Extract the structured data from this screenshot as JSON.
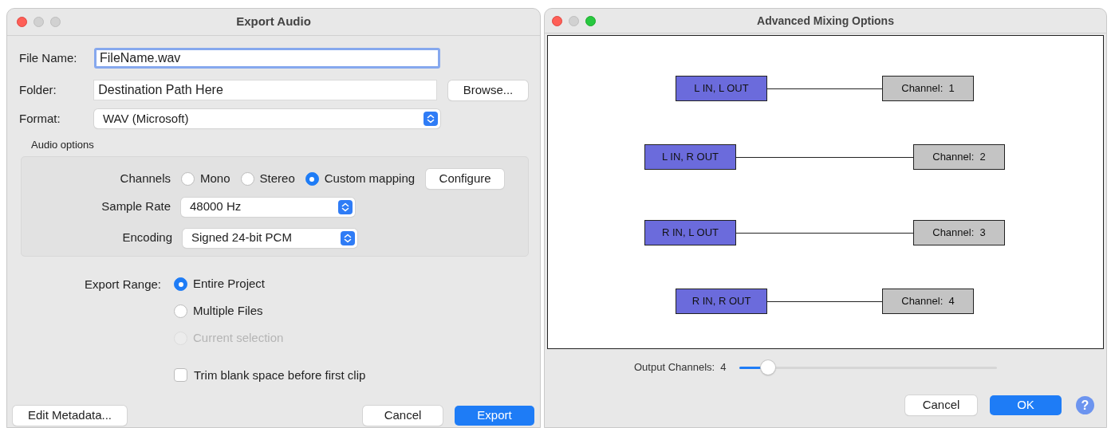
{
  "export_window": {
    "title": "Export Audio",
    "file_name": {
      "label": "File Name:",
      "value": "FileName.wav",
      "focused": true
    },
    "folder": {
      "label": "Folder:",
      "value": "Destination Path Here",
      "button": "Browse..."
    },
    "format": {
      "label": "Format:",
      "value": "WAV (Microsoft)"
    },
    "audio_options": {
      "heading": "Audio options",
      "channels": {
        "label": "Channels",
        "options": [
          {
            "label": "Mono",
            "selected": false
          },
          {
            "label": "Stereo",
            "selected": false
          },
          {
            "label": "Custom mapping",
            "selected": true
          }
        ],
        "button": "Configure"
      },
      "sample_rate": {
        "label": "Sample Rate",
        "value": "48000 Hz"
      },
      "encoding": {
        "label": "Encoding",
        "value": "Signed 24-bit PCM"
      }
    },
    "export_range": {
      "label": "Export Range:",
      "options": [
        {
          "label": "Entire Project",
          "selected": true,
          "disabled": false
        },
        {
          "label": "Multiple Files",
          "selected": false,
          "disabled": false
        },
        {
          "label": "Current selection",
          "selected": false,
          "disabled": true
        }
      ]
    },
    "trim": {
      "label": "Trim blank space before first clip",
      "checked": false
    },
    "buttons": {
      "edit_metadata": "Edit Metadata...",
      "cancel": "Cancel",
      "export": "Export"
    }
  },
  "mixing_window": {
    "title": "Advanced Mixing Options",
    "mappings": [
      {
        "input": "L IN, L OUT",
        "output": "Channel:  1"
      },
      {
        "input": "L IN, R OUT",
        "output": "Channel:  2"
      },
      {
        "input": "R IN, L OUT",
        "output": "Channel:  3"
      },
      {
        "input": "R IN, R OUT",
        "output": "Channel:  4"
      }
    ],
    "output_channels": {
      "label": "Output Channels:",
      "value": "4",
      "level": 0.11
    },
    "buttons": {
      "cancel": "Cancel",
      "ok": "OK",
      "help": "?"
    }
  }
}
